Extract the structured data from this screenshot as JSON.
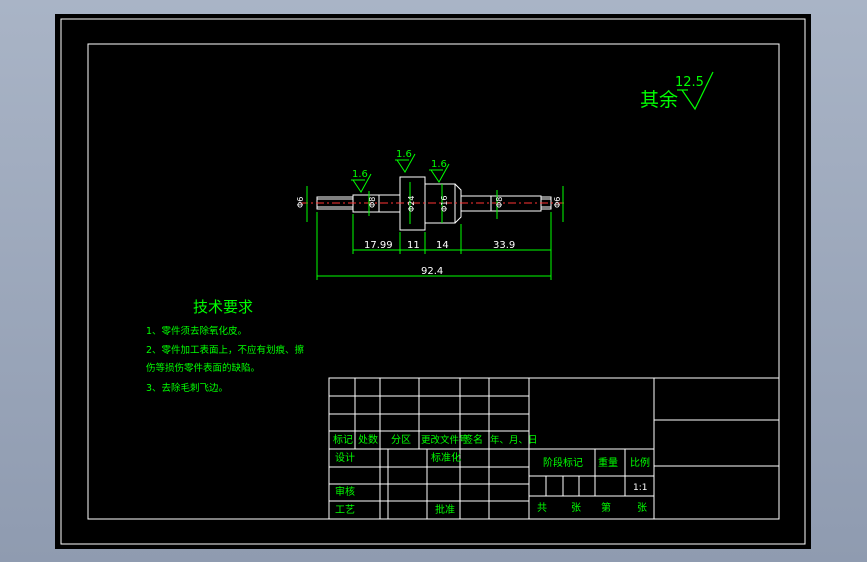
{
  "roughness": {
    "prefix": "其余",
    "value": "12.5"
  },
  "part": {
    "surface_marks": [
      "1.6",
      "1.6",
      "1.6"
    ],
    "diameters": [
      "Φ6",
      "Φ8",
      "Φ24",
      "Φ16",
      "Φ8",
      "Φ6"
    ],
    "dims": {
      "d1": "17.99",
      "d2": "11",
      "d3": "14",
      "d4": "33.9",
      "total": "92.4"
    }
  },
  "tech": {
    "title": "技术要求",
    "lines": [
      "1、零件须去除氧化皮。",
      "2、零件加工表面上，不应有划痕、擦",
      "伤等损伤零件表面的缺陷。",
      "3、去除毛刺飞边。"
    ]
  },
  "titleblock": {
    "header": [
      "标记",
      "处数",
      "分区",
      "更改文件号",
      "签名",
      "年、月、日"
    ],
    "design": "设计",
    "standard": "标准化",
    "review": "审核",
    "process": "工艺",
    "approve": "批准",
    "stage": "阶段标记",
    "weight": "重量",
    "scale_label": "比例",
    "scale": "1:1",
    "gong": "共",
    "zhang": "张",
    "di": "第",
    "zhang2": "张"
  }
}
